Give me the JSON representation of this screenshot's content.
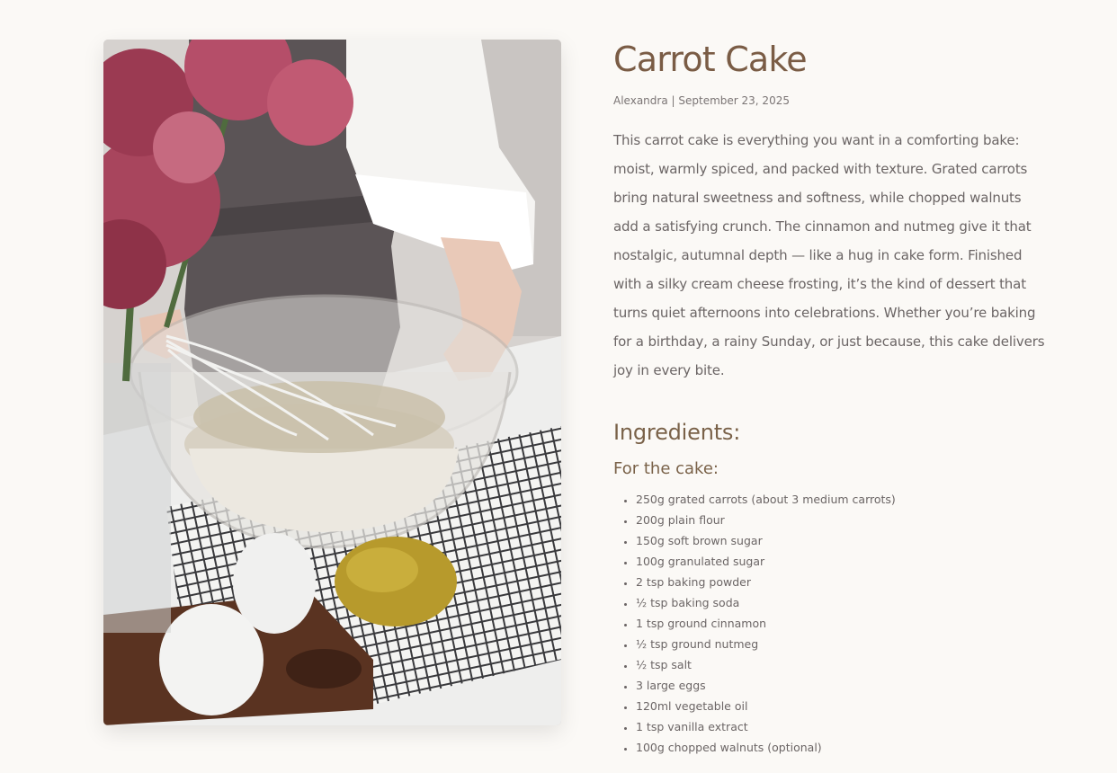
{
  "hero_image": {
    "alt": "Hands whisking batter in a glass bowl beside eggs, a lemon and pink flowers"
  },
  "recipe": {
    "title": "Carrot Cake",
    "author": "Alexandra",
    "separator": "|",
    "date": "September 23, 2025",
    "intro": "This carrot cake is everything you want in a comforting bake: moist, warmly spiced, and packed with texture. Grated carrots bring natural sweetness and softness, while chopped walnuts add a satisfying crunch. The cinnamon and nutmeg give it that nostalgic, autumnal depth — like a hug in cake form. Finished with a silky cream cheese frosting, it’s the kind of dessert that turns quiet afternoons into celebrations. Whether you’re baking for a birthday, a rainy Sunday, or just because, this cake delivers joy in every bite."
  },
  "ingredients": {
    "heading": "Ingredients:",
    "cake_heading": "For the cake:",
    "cake_items": [
      "250g grated carrots (about 3 medium carrots)",
      "200g plain flour",
      "150g soft brown sugar",
      "100g granulated sugar",
      "2 tsp baking powder",
      "½ tsp baking soda",
      "1 tsp ground cinnamon",
      "½ tsp ground nutmeg",
      "½ tsp salt",
      "3 large eggs",
      "120ml vegetable oil",
      "1 tsp vanilla extract",
      "100g chopped walnuts (optional)"
    ]
  }
}
